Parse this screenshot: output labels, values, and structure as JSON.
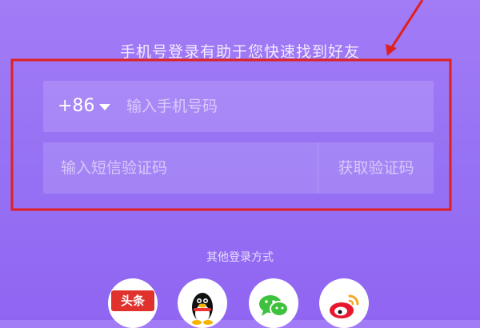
{
  "login_hint": "手机号登录有助于您快速找到好友",
  "phone": {
    "country_code": "+86",
    "placeholder": "输入手机号码"
  },
  "sms": {
    "placeholder": "输入短信验证码",
    "get_code_label": "获取验证码"
  },
  "other_login": {
    "title": "其他登录方式",
    "providers": [
      {
        "name": "toutiao",
        "label": "头条",
        "icon": "toutiao-icon",
        "color": "#e0312d"
      },
      {
        "name": "qq",
        "icon": "qq-penguin-icon",
        "color": "#000000"
      },
      {
        "name": "wechat",
        "icon": "wechat-icon",
        "color": "#3ec13d"
      },
      {
        "name": "weibo",
        "icon": "weibo-icon",
        "color": "#e6162d"
      }
    ]
  },
  "annotation": {
    "color": "#e02020"
  }
}
